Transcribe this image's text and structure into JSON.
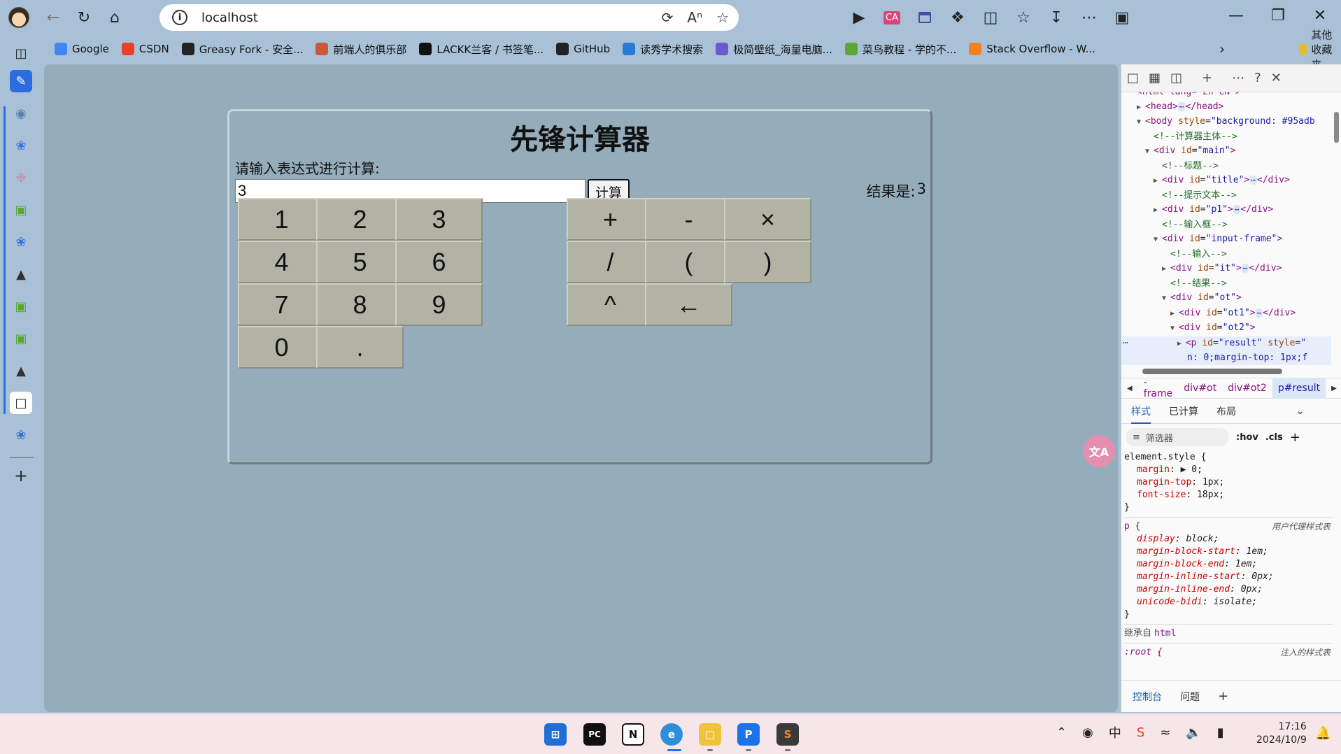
{
  "browser": {
    "url": "localhost",
    "bookmarks": [
      {
        "label": "Google",
        "color": "#4285f4"
      },
      {
        "label": "CSDN",
        "color": "#e8402b"
      },
      {
        "label": "Greasy Fork - 安全...",
        "color": "#222222"
      },
      {
        "label": "前端人的俱乐部",
        "color": "#c85a3a"
      },
      {
        "label": "LACKK兰客 / 书签笔...",
        "color": "#111111"
      },
      {
        "label": "GitHub",
        "color": "#222222"
      },
      {
        "label": "读秀学术搜索",
        "color": "#2b7bd6"
      },
      {
        "label": "极简壁纸_海量电脑...",
        "color": "#6a5acd"
      },
      {
        "label": "菜鸟教程 - 学的不...",
        "color": "#5aa832"
      },
      {
        "label": "Stack Overflow - W...",
        "color": "#f48024"
      }
    ],
    "other_bookmarks": "其他收藏夹"
  },
  "calculator": {
    "title": "先锋计算器",
    "prompt": "请输入表达式进行计算:",
    "expression_value": "3",
    "calc_button": "计算",
    "result_label": "结果是:",
    "result_value": "3",
    "keys_left": [
      "1",
      "2",
      "3",
      "4",
      "5",
      "6",
      "7",
      "8",
      "9",
      "0",
      "."
    ],
    "keys_right": [
      "+",
      "-",
      "×",
      "/",
      "(",
      ")",
      "^",
      "←"
    ]
  },
  "devtools": {
    "breadcrumbs": [
      "-frame",
      "div#ot",
      "div#ot2",
      "p#result"
    ],
    "style_tabs": [
      "样式",
      "已计算",
      "布局"
    ],
    "filter_placeholder": "筛选器",
    "hov": ":hov",
    "cls": ".cls",
    "element_style_selector": "element.style {",
    "element_style_props": [
      {
        "name": "margin",
        "value": "▶ 0;"
      },
      {
        "name": "margin-top",
        "value": "1px;"
      },
      {
        "name": "font-size",
        "value": "18px;"
      }
    ],
    "p_selector": "p {",
    "ua_label": "用户代理样式表",
    "p_props": [
      {
        "name": "display",
        "value": "block;"
      },
      {
        "name": "margin-block-start",
        "value": "1em;"
      },
      {
        "name": "margin-block-end",
        "value": "1em;"
      },
      {
        "name": "margin-inline-start",
        "value": "0px;"
      },
      {
        "name": "margin-inline-end",
        "value": "0px;"
      },
      {
        "name": "unicode-bidi",
        "value": "isolate;"
      }
    ],
    "inherited_label": "继承自",
    "inherited_from": "html",
    "root_selector": ":root {",
    "injected_label": "注入的样式表",
    "bottom_tabs": [
      "控制台",
      "问题"
    ]
  },
  "taskbar": {
    "time": "17:16",
    "date": "2024/10/9"
  }
}
